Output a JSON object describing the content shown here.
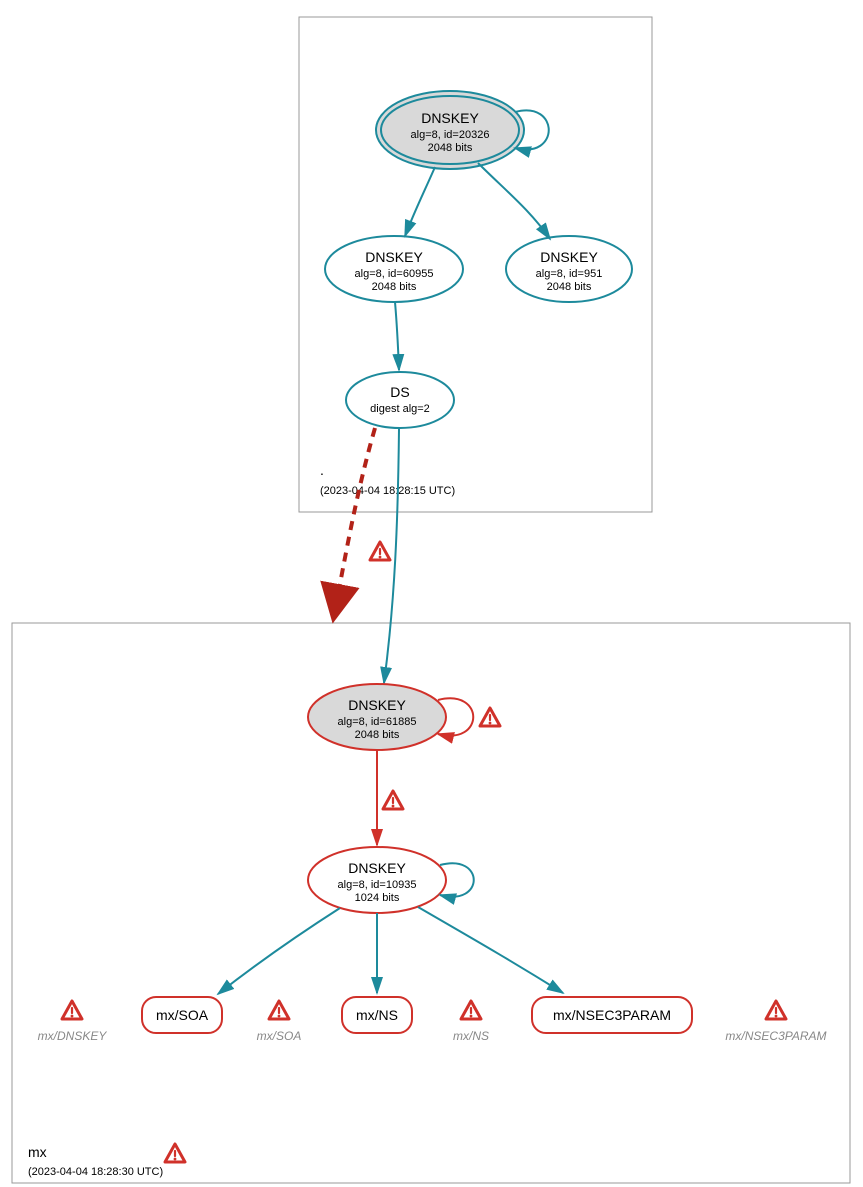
{
  "colors": {
    "secure": "#1d8a9c",
    "warn": "#d0312a",
    "gray": "#999999",
    "fill_ksk": "#d9d9d9"
  },
  "zones": {
    "root": {
      "label": ".",
      "timestamp": "(2023-04-04 18:28:15 UTC)"
    },
    "mx": {
      "label": "mx",
      "timestamp": "(2023-04-04 18:28:30 UTC)"
    }
  },
  "nodes": {
    "root_ksk": {
      "title": "DNSKEY",
      "line2": "alg=8, id=20326",
      "line3": "2048 bits"
    },
    "root_zsk1": {
      "title": "DNSKEY",
      "line2": "alg=8, id=60955",
      "line3": "2048 bits"
    },
    "root_zsk2": {
      "title": "DNSKEY",
      "line2": "alg=8, id=951",
      "line3": "2048 bits"
    },
    "root_ds": {
      "title": "DS",
      "line2": "digest alg=2"
    },
    "mx_ksk": {
      "title": "DNSKEY",
      "line2": "alg=8, id=61885",
      "line3": "2048 bits"
    },
    "mx_zsk": {
      "title": "DNSKEY",
      "line2": "alg=8, id=10935",
      "line3": "1024 bits"
    }
  },
  "rr": {
    "soa": "mx/SOA",
    "ns": "mx/NS",
    "nsec3": "mx/NSEC3PARAM"
  },
  "warn_labels": {
    "dnskey": "mx/DNSKEY",
    "soa": "mx/SOA",
    "ns": "mx/NS",
    "nsec3": "mx/NSEC3PARAM"
  }
}
